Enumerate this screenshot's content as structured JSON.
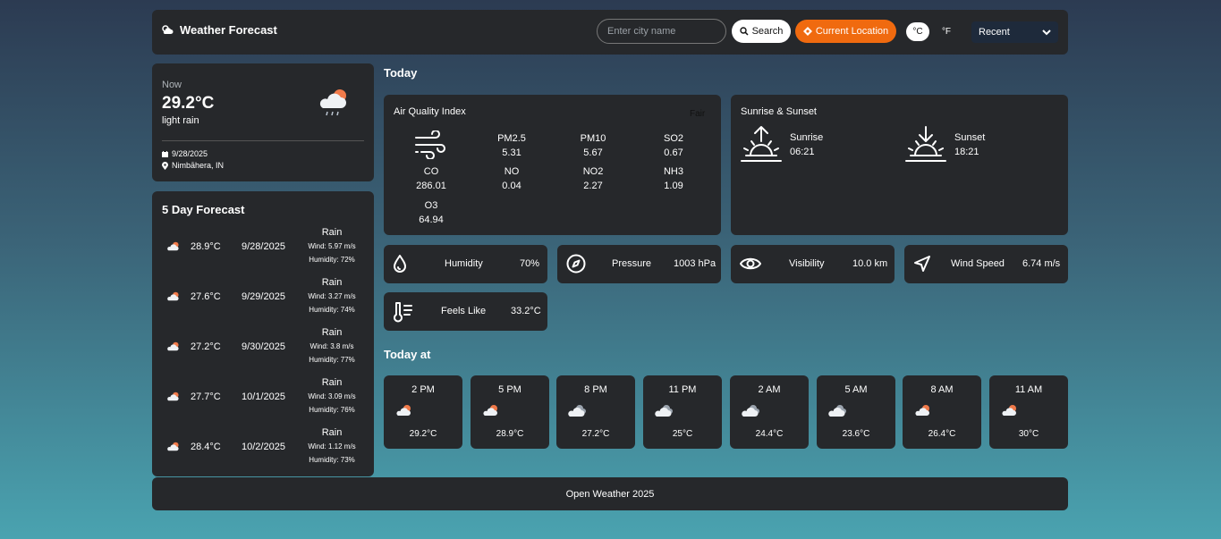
{
  "header": {
    "title": "Weather Forecast",
    "search_placeholder": "Enter city name",
    "search_label": "Search",
    "location_label": "Current Location",
    "unit_c": "°C",
    "unit_f": "°F",
    "recent_label": "Recent"
  },
  "now": {
    "label": "Now",
    "temp": "29.2°C",
    "desc": "light rain",
    "date": "9/28/2025",
    "location": "Nimbāhera, IN"
  },
  "forecast": {
    "title": "5 Day Forecast",
    "days": [
      {
        "temp": "28.9°C",
        "date": "9/28/2025",
        "cond": "Rain",
        "wind": "Wind: 5.97 m/s",
        "humidity": "Humidity: 72%"
      },
      {
        "temp": "27.6°C",
        "date": "9/29/2025",
        "cond": "Rain",
        "wind": "Wind: 3.27 m/s",
        "humidity": "Humidity: 74%"
      },
      {
        "temp": "27.2°C",
        "date": "9/30/2025",
        "cond": "Rain",
        "wind": "Wind: 3.8 m/s",
        "humidity": "Humidity: 77%"
      },
      {
        "temp": "27.7°C",
        "date": "10/1/2025",
        "cond": "Rain",
        "wind": "Wind: 3.09 m/s",
        "humidity": "Humidity: 76%"
      },
      {
        "temp": "28.4°C",
        "date": "10/2/2025",
        "cond": "Rain",
        "wind": "Wind: 1.12 m/s",
        "humidity": "Humidity: 73%"
      }
    ]
  },
  "today": {
    "title": "Today",
    "aqi": {
      "title": "Air Quality Index",
      "status": "Fair",
      "items": [
        {
          "name": "PM2.5",
          "value": "5.31"
        },
        {
          "name": "PM10",
          "value": "5.67"
        },
        {
          "name": "SO2",
          "value": "0.67"
        },
        {
          "name": "CO",
          "value": "286.01"
        },
        {
          "name": "NO",
          "value": "0.04"
        },
        {
          "name": "NO2",
          "value": "2.27"
        },
        {
          "name": "NH3",
          "value": "1.09"
        },
        {
          "name": "O3",
          "value": "64.94"
        }
      ]
    },
    "sun": {
      "title": "Sunrise & Sunset",
      "sunrise_label": "Sunrise",
      "sunrise": "06:21",
      "sunset_label": "Sunset",
      "sunset": "18:21"
    },
    "highlights": {
      "humidity_label": "Humidity",
      "humidity": "70%",
      "pressure_label": "Pressure",
      "pressure": "1003 hPa",
      "visibility_label": "Visibility",
      "visibility": "10.0 km",
      "wind_label": "Wind Speed",
      "wind": "6.74 m/s",
      "feels_label": "Feels Like",
      "feels": "33.2°C"
    }
  },
  "today_at": {
    "title": "Today at",
    "hours": [
      {
        "time": "2 PM",
        "temp": "29.2°C",
        "icon": "sun-cloud-icon"
      },
      {
        "time": "5 PM",
        "temp": "28.9°C",
        "icon": "sun-cloud-icon"
      },
      {
        "time": "8 PM",
        "temp": "27.2°C",
        "icon": "cloud-icon"
      },
      {
        "time": "11 PM",
        "temp": "25°C",
        "icon": "cloud-icon"
      },
      {
        "time": "2 AM",
        "temp": "24.4°C",
        "icon": "cloud-icon"
      },
      {
        "time": "5 AM",
        "temp": "23.6°C",
        "icon": "cloud-icon"
      },
      {
        "time": "8 AM",
        "temp": "26.4°C",
        "icon": "sun-cloud-icon"
      },
      {
        "time": "11 AM",
        "temp": "30°C",
        "icon": "sun-cloud-icon"
      }
    ]
  },
  "footer": {
    "text": "Open Weather 2025"
  },
  "colors": {
    "accent": "#f06a0f",
    "card": "#26282b"
  }
}
